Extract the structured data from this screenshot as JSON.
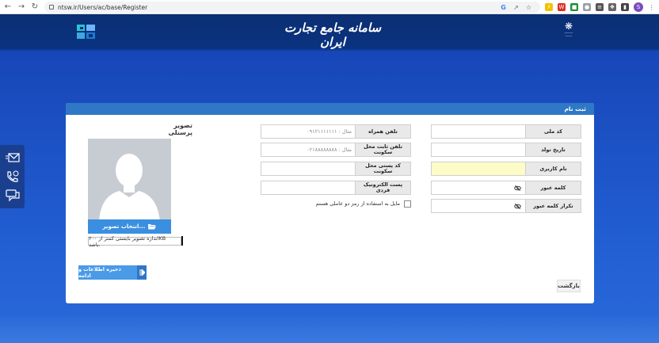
{
  "browser": {
    "url": "ntsw.ir/Users/ac/base/Register",
    "profile_initial": "S"
  },
  "header": {
    "title": "سامانه جامع تجارت ایران"
  },
  "card": {
    "title": "ثبت نام"
  },
  "form": {
    "national_id_label": "کد ملی",
    "birth_date_label": "تاریخ تولد",
    "username_label": "نام کاربری",
    "password_label": "کلمه عبور",
    "repeat_password_label": "تکرار کلمه عبور",
    "mobile_label": "تلفن همراه",
    "mobile_placeholder": "مثال : ۰۹۱۲۱۱۱۱۱۱۱",
    "landline_label": "تلفن ثابت محل سکونت",
    "landline_placeholder": "مثال : ۰۲۱۸۸۸۸۸۸۸۸",
    "postal_code_label": "کد پستی محل سکونت",
    "email_label": "پست الکترونیک فردی",
    "two_factor_label": "مایل به استفاده از رمز دو عاملی هستم"
  },
  "photo": {
    "title": "تصویر پرسنلی",
    "upload_label": "انتخاب تصویر...",
    "size_note": "اندازه تصویر بایستی کمتر از ۲۰۰KB باشد."
  },
  "actions": {
    "save_label": "ذخیره اطلاعات و ادامه",
    "back_label": "بازگشت"
  },
  "colors": {
    "header_bg": "#0b2f73",
    "page_bg": "#1f55c8",
    "card_header": "#2e78c6",
    "button": "#4a9ae8",
    "highlight_input": "#fdfbc8"
  }
}
